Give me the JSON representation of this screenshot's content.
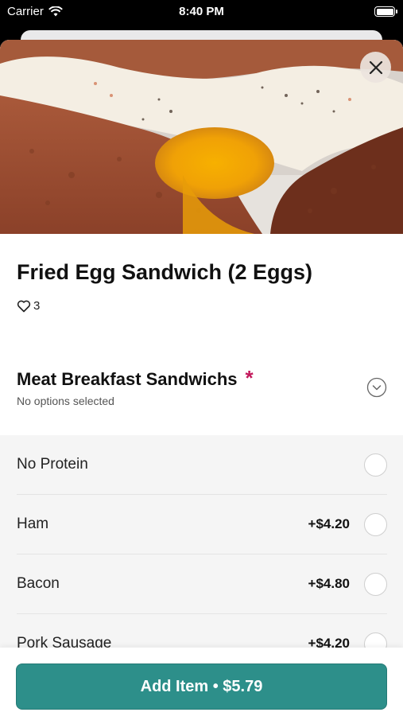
{
  "status_bar": {
    "carrier": "Carrier",
    "time": "8:40 PM"
  },
  "hero": {
    "image": "fried-egg-sandwich-photo",
    "close_icon": "close-icon"
  },
  "item": {
    "title": "Fried Egg Sandwich (2 Eggs)",
    "likes": "3"
  },
  "section": {
    "title": "Meat Breakfast Sandwichs",
    "required_mark": "*",
    "subtitle": "No options selected"
  },
  "options": [
    {
      "label": "No Protein",
      "price": ""
    },
    {
      "label": "Ham",
      "price": "+$4.20"
    },
    {
      "label": "Bacon",
      "price": "+$4.80"
    },
    {
      "label": "Pork Sausage",
      "price": "+$4.20"
    }
  ],
  "footer": {
    "button_label": "Add Item • $5.79"
  },
  "colors": {
    "accent": "#2d8f8a",
    "required": "#c2185b"
  }
}
